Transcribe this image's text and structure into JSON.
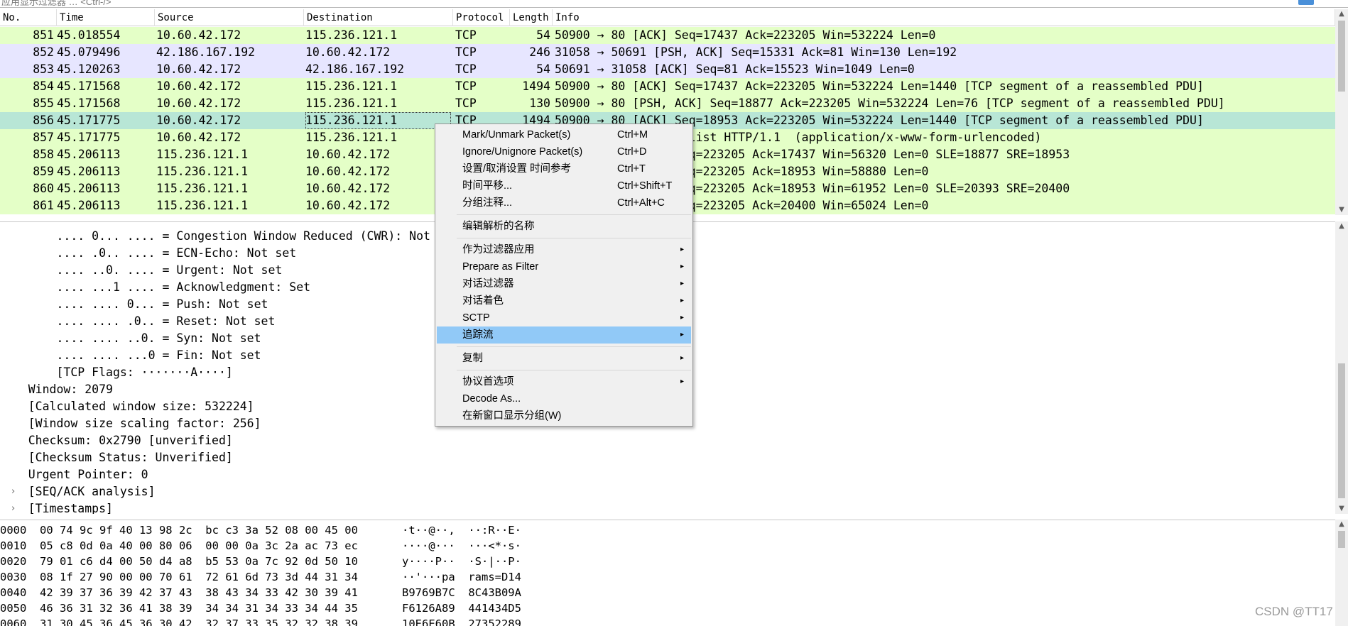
{
  "filter_bar": {
    "placeholder": "应用显示过滤器 … <Ctrl-/>"
  },
  "packet_list": {
    "columns": [
      "No.",
      "Time",
      "Source",
      "Destination",
      "Protocol",
      "Length",
      "Info"
    ],
    "rows": [
      {
        "no": "851",
        "time": "45.018554",
        "src": "10.60.42.172",
        "dst": "115.236.121.1",
        "proto": "TCP",
        "len": "54",
        "info": "50900 → 80 [ACK] Seq=17437 Ack=223205 Win=532224 Len=0",
        "bg": "#e4ffc7"
      },
      {
        "no": "852",
        "time": "45.079496",
        "src": "42.186.167.192",
        "dst": "10.60.42.172",
        "proto": "TCP",
        "len": "246",
        "info": "31058 → 50691 [PSH, ACK] Seq=15331 Ack=81 Win=130 Len=192",
        "bg": "#e7e6ff"
      },
      {
        "no": "853",
        "time": "45.120263",
        "src": "10.60.42.172",
        "dst": "42.186.167.192",
        "proto": "TCP",
        "len": "54",
        "info": "50691 → 31058 [ACK] Seq=81 Ack=15523 Win=1049 Len=0",
        "bg": "#e7e6ff"
      },
      {
        "no": "854",
        "time": "45.171568",
        "src": "10.60.42.172",
        "dst": "115.236.121.1",
        "proto": "TCP",
        "len": "1494",
        "info": "50900 → 80 [ACK] Seq=17437 Ack=223205 Win=532224 Len=1440 [TCP segment of a reassembled PDU]",
        "bg": "#e4ffc7"
      },
      {
        "no": "855",
        "time": "45.171568",
        "src": "10.60.42.172",
        "dst": "115.236.121.1",
        "proto": "TCP",
        "len": "130",
        "info": "50900 → 80 [PSH, ACK] Seq=18877 Ack=223205 Win=532224 Len=76 [TCP segment of a reassembled PDU]",
        "bg": "#e4ffc7"
      },
      {
        "no": "856",
        "time": "45.171775",
        "src": "10.60.42.172",
        "dst": "115.236.121.1",
        "proto": "TCP",
        "len": "1494",
        "info": "50900 → 80 [ACK] Seq=18953 Ack=223205 Win=532224 Len=1440 [TCP segment of a reassembled PDU]",
        "bg": "#b8e6d6"
      },
      {
        "no": "857",
        "time": "45.171775",
        "src": "10.60.42.172",
        "dst": "115.236.121.1",
        "proto": "HTTP",
        "len": "",
        "info": "POST /intelligence/list HTTP/1.1  (application/x-www-form-urlencoded)",
        "bg": "#e4ffc7"
      },
      {
        "no": "858",
        "time": "45.206113",
        "src": "115.236.121.1",
        "dst": "10.60.42.172",
        "proto": "TCP",
        "len": "",
        "info": "80 → 50900 [ACK] Seq=223205 Ack=17437 Win=56320 Len=0 SLE=18877 SRE=18953",
        "bg": "#e4ffc7"
      },
      {
        "no": "859",
        "time": "45.206113",
        "src": "115.236.121.1",
        "dst": "10.60.42.172",
        "proto": "TCP",
        "len": "",
        "info": "80 → 50900 [ACK] Seq=223205 Ack=18953 Win=58880 Len=0",
        "bg": "#e4ffc7"
      },
      {
        "no": "860",
        "time": "45.206113",
        "src": "115.236.121.1",
        "dst": "10.60.42.172",
        "proto": "TCP",
        "len": "",
        "info": "80 → 50900 [ACK] Seq=223205 Ack=18953 Win=61952 Len=0 SLE=20393 SRE=20400",
        "bg": "#e4ffc7"
      },
      {
        "no": "861",
        "time": "45.206113",
        "src": "115.236.121.1",
        "dst": "10.60.42.172",
        "proto": "TCP",
        "len": "",
        "info": "80 → 50900 [ACK] Seq=223205 Ack=20400 Win=65024 Len=0",
        "bg": "#e4ffc7"
      }
    ]
  },
  "details": {
    "lines": [
      {
        "text": "        .... 0... .... = Congestion Window Reduced (CWR): Not set",
        "expand": ""
      },
      {
        "text": "        .... .0.. .... = ECN-Echo: Not set",
        "expand": ""
      },
      {
        "text": "        .... ..0. .... = Urgent: Not set",
        "expand": ""
      },
      {
        "text": "        .... ...1 .... = Acknowledgment: Set",
        "expand": ""
      },
      {
        "text": "        .... .... 0... = Push: Not set",
        "expand": ""
      },
      {
        "text": "        .... .... .0.. = Reset: Not set",
        "expand": ""
      },
      {
        "text": "        .... .... ..0. = Syn: Not set",
        "expand": ""
      },
      {
        "text": "        .... .... ...0 = Fin: Not set",
        "expand": ""
      },
      {
        "text": "        [TCP Flags: ·······A····]",
        "expand": ""
      },
      {
        "text": "    Window: 2079",
        "expand": ""
      },
      {
        "text": "    [Calculated window size: 532224]",
        "expand": ""
      },
      {
        "text": "    [Window size scaling factor: 256]",
        "expand": ""
      },
      {
        "text": "    Checksum: 0x2790 [unverified]",
        "expand": ""
      },
      {
        "text": "    [Checksum Status: Unverified]",
        "expand": ""
      },
      {
        "text": "    Urgent Pointer: 0",
        "expand": ""
      },
      {
        "text": "    [SEQ/ACK analysis]",
        "expand": "›"
      },
      {
        "text": "    [Timestamps]",
        "expand": "›"
      }
    ]
  },
  "bytes": {
    "lines": [
      {
        "off": "0000",
        "hex": "00 74 9c 9f 40 13 98 2c  bc c3 3a 52 08 00 45 00",
        "ascii": "·t··@··,  ··:R··E·"
      },
      {
        "off": "0010",
        "hex": "05 c8 0d 0a 40 00 80 06  00 00 0a 3c 2a ac 73 ec",
        "ascii": "····@···  ···<*·s·"
      },
      {
        "off": "0020",
        "hex": "79 01 c6 d4 00 50 d4 a8  b5 53 0a 7c 92 0d 50 10",
        "ascii": "y····P··  ·S·|··P·"
      },
      {
        "off": "0030",
        "hex": "08 1f 27 90 00 00 70 61  72 61 6d 73 3d 44 31 34",
        "ascii": "··'···pa  rams=D14"
      },
      {
        "off": "0040",
        "hex": "42 39 37 36 39 42 37 43  38 43 34 33 42 30 39 41",
        "ascii": "B9769B7C  8C43B09A"
      },
      {
        "off": "0050",
        "hex": "46 36 31 32 36 41 38 39  34 34 31 34 33 34 44 35",
        "ascii": "F6126A89  441434D5"
      },
      {
        "off": "0060",
        "hex": "31 30 45 36 45 36 30 42  32 37 33 35 32 32 38 39",
        "ascii": "10E6E60B  27352289"
      }
    ]
  },
  "context_menu": {
    "items": [
      {
        "type": "item",
        "label": "Mark/Unmark Packet(s)",
        "shortcut": "Ctrl+M",
        "submenu": false,
        "highlight": false,
        "name": "menu-item-mark-packet"
      },
      {
        "type": "item",
        "label": "Ignore/Unignore Packet(s)",
        "shortcut": "Ctrl+D",
        "submenu": false,
        "highlight": false,
        "name": "menu-item-ignore-packet"
      },
      {
        "type": "item",
        "label": "设置/取消设置 时间参考",
        "shortcut": "Ctrl+T",
        "submenu": false,
        "highlight": false,
        "name": "menu-item-time-reference"
      },
      {
        "type": "item",
        "label": "时间平移...",
        "shortcut": "Ctrl+Shift+T",
        "submenu": false,
        "highlight": false,
        "name": "menu-item-time-shift"
      },
      {
        "type": "item",
        "label": "分组注释...",
        "shortcut": "Ctrl+Alt+C",
        "submenu": false,
        "highlight": false,
        "name": "menu-item-packet-comment"
      },
      {
        "type": "sep"
      },
      {
        "type": "item",
        "label": "编辑解析的名称",
        "shortcut": "",
        "submenu": false,
        "highlight": false,
        "name": "menu-item-edit-resolved-name"
      },
      {
        "type": "sep"
      },
      {
        "type": "item",
        "label": "作为过滤器应用",
        "shortcut": "",
        "submenu": true,
        "highlight": false,
        "name": "menu-item-apply-as-filter"
      },
      {
        "type": "item",
        "label": "Prepare as Filter",
        "shortcut": "",
        "submenu": true,
        "highlight": false,
        "name": "menu-item-prepare-as-filter"
      },
      {
        "type": "item",
        "label": "对话过滤器",
        "shortcut": "",
        "submenu": true,
        "highlight": false,
        "name": "menu-item-conversation-filter"
      },
      {
        "type": "item",
        "label": "对话着色",
        "shortcut": "",
        "submenu": true,
        "highlight": false,
        "name": "menu-item-colorize-conversation"
      },
      {
        "type": "item",
        "label": "SCTP",
        "shortcut": "",
        "submenu": true,
        "highlight": false,
        "name": "menu-item-sctp"
      },
      {
        "type": "item",
        "label": "追踪流",
        "shortcut": "",
        "submenu": true,
        "highlight": true,
        "name": "menu-item-follow-stream"
      },
      {
        "type": "sep"
      },
      {
        "type": "item",
        "label": "复制",
        "shortcut": "",
        "submenu": true,
        "highlight": false,
        "name": "menu-item-copy"
      },
      {
        "type": "sep"
      },
      {
        "type": "item",
        "label": "协议首选项",
        "shortcut": "",
        "submenu": true,
        "highlight": false,
        "name": "menu-item-protocol-preferences"
      },
      {
        "type": "item",
        "label": "Decode As...",
        "shortcut": "",
        "submenu": false,
        "highlight": false,
        "name": "menu-item-decode-as"
      },
      {
        "type": "item",
        "label": "在新窗口显示分组(W)",
        "shortcut": "",
        "submenu": false,
        "highlight": false,
        "name": "menu-item-show-in-new-window"
      }
    ]
  },
  "watermark": "CSDN @TT17",
  "colors": {
    "tcp_row": "#e4ffc7",
    "other_conversation_row": "#e7e6ff",
    "selected_row": "#b8e6d6",
    "menu_highlight": "#91c9f7"
  }
}
